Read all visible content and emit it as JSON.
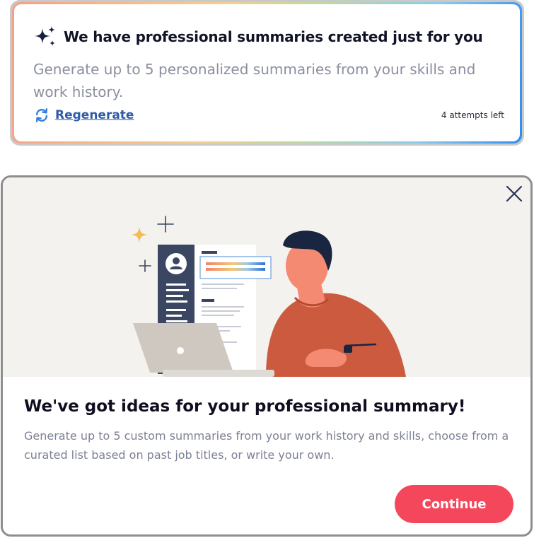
{
  "summary_card": {
    "title": "We have professional summaries created just for you",
    "description": "Generate up to 5 personalized summaries from your skills and work history.",
    "regenerate_label": "Regenerate",
    "attempts_left": "4 attempts left",
    "icons": {
      "title": "sparkle-icon",
      "regenerate": "refresh-icon"
    }
  },
  "modal": {
    "title": "We've got ideas for your professional summary!",
    "description": "Generate up to 5 custom summaries from your work history and skills, choose from a curated list based on past job titles, or write your own.",
    "continue_label": "Continue",
    "icons": {
      "close": "close-icon"
    }
  },
  "colors": {
    "accent": "#f5475c",
    "link": "#2e5aa8",
    "hero_background": "#f4f2ee",
    "resume_sidebar": "#3a4662",
    "person_sweater": "#cc5a3e"
  }
}
